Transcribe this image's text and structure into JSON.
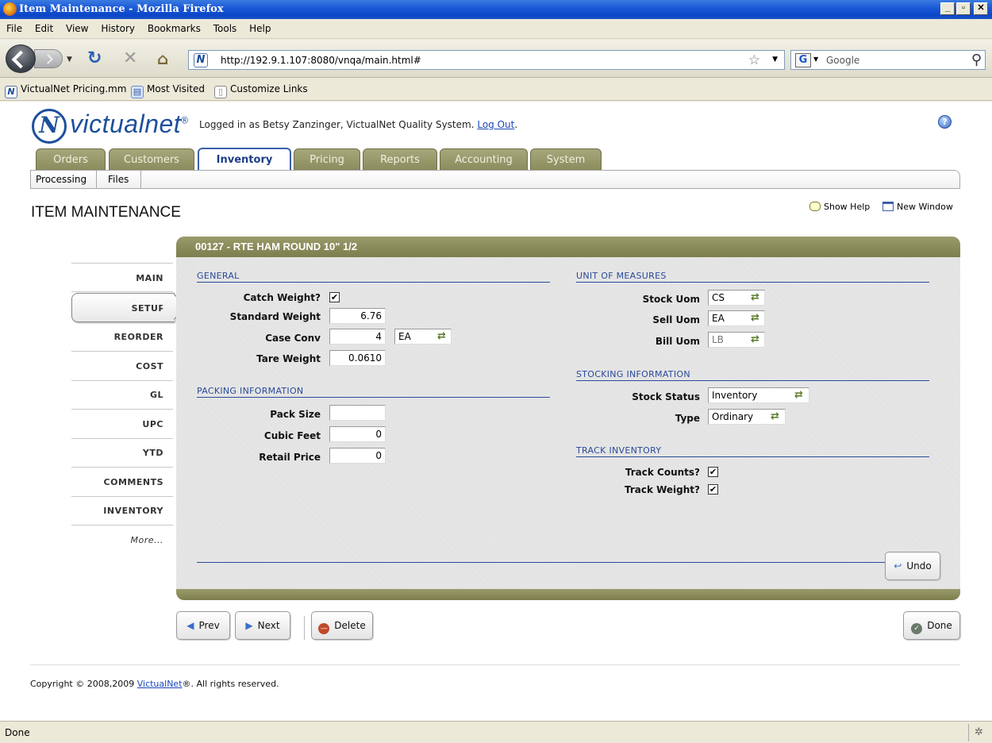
{
  "window": {
    "title": "Item Maintenance - Mozilla Firefox",
    "min": "_",
    "max": "▫",
    "close": "✕"
  },
  "menu": [
    "File",
    "Edit",
    "View",
    "History",
    "Bookmarks",
    "Tools",
    "Help"
  ],
  "nav": {
    "url": "http://192.9.1.107:8080/vnqa/main.html#",
    "search_placeholder": "Google"
  },
  "bookmarks": [
    "VictualNet Pricing.mm",
    "Most Visited",
    "Customize Links"
  ],
  "header": {
    "logo": "victualnet",
    "logo_reg": "®",
    "logged_in": "Logged in as Betsy Zanzinger, VictualNet Quality System. ",
    "logout": "Log Out",
    "logout_suffix": ".",
    "help_glyph": "?"
  },
  "tabs": [
    "Orders",
    "Customers",
    "Inventory",
    "Pricing",
    "Reports",
    "Accounting",
    "System"
  ],
  "active_tab": "Inventory",
  "subtabs": [
    "Processing",
    "Files"
  ],
  "page": {
    "title": "ITEM MAINTENANCE",
    "show_help": "Show Help",
    "new_window": "New Window"
  },
  "sidenav": [
    "MAIN",
    "SETUP",
    "REORDER",
    "COST",
    "GL",
    "UPC",
    "YTD",
    "COMMENTS",
    "INVENTORY",
    "More..."
  ],
  "active_sidenav": "SETUP",
  "item_header": "00127 - RTE HAM ROUND 10\" 1/2",
  "general": {
    "title": "GENERAL",
    "catch_weight_label": "Catch Weight?",
    "catch_weight": true,
    "standard_weight_label": "Standard Weight",
    "standard_weight": "6.76",
    "case_conv_label": "Case Conv",
    "case_conv": "4",
    "case_conv_uom": "EA",
    "tare_weight_label": "Tare Weight",
    "tare_weight": "0.0610"
  },
  "packing": {
    "title": "PACKING INFORMATION",
    "pack_size_label": "Pack Size",
    "pack_size": "",
    "cubic_feet_label": "Cubic Feet",
    "cubic_feet": "0",
    "retail_price_label": "Retail Price",
    "retail_price": "0"
  },
  "uom": {
    "title": "UNIT OF MEASURES",
    "stock_label": "Stock Uom",
    "stock": "CS",
    "sell_label": "Sell Uom",
    "sell": "EA",
    "bill_label": "Bill Uom",
    "bill": "LB"
  },
  "stocking": {
    "title": "STOCKING INFORMATION",
    "status_label": "Stock Status",
    "status": "Inventory",
    "type_label": "Type",
    "type": "Ordinary"
  },
  "track": {
    "title": "TRACK INVENTORY",
    "counts_label": "Track Counts?",
    "counts": true,
    "weight_label": "Track Weight?",
    "weight": true
  },
  "buttons": {
    "undo": "Undo",
    "prev": "Prev",
    "next": "Next",
    "delete": "Delete",
    "done": "Done"
  },
  "footer": {
    "copyright_prefix": "Copyright © 2008,2009 ",
    "copyright_link": "VictualNet",
    "copyright_suffix": "®. All rights reserved."
  },
  "status": "Done",
  "check_glyph": "✔",
  "swap_glyph": "⇄"
}
